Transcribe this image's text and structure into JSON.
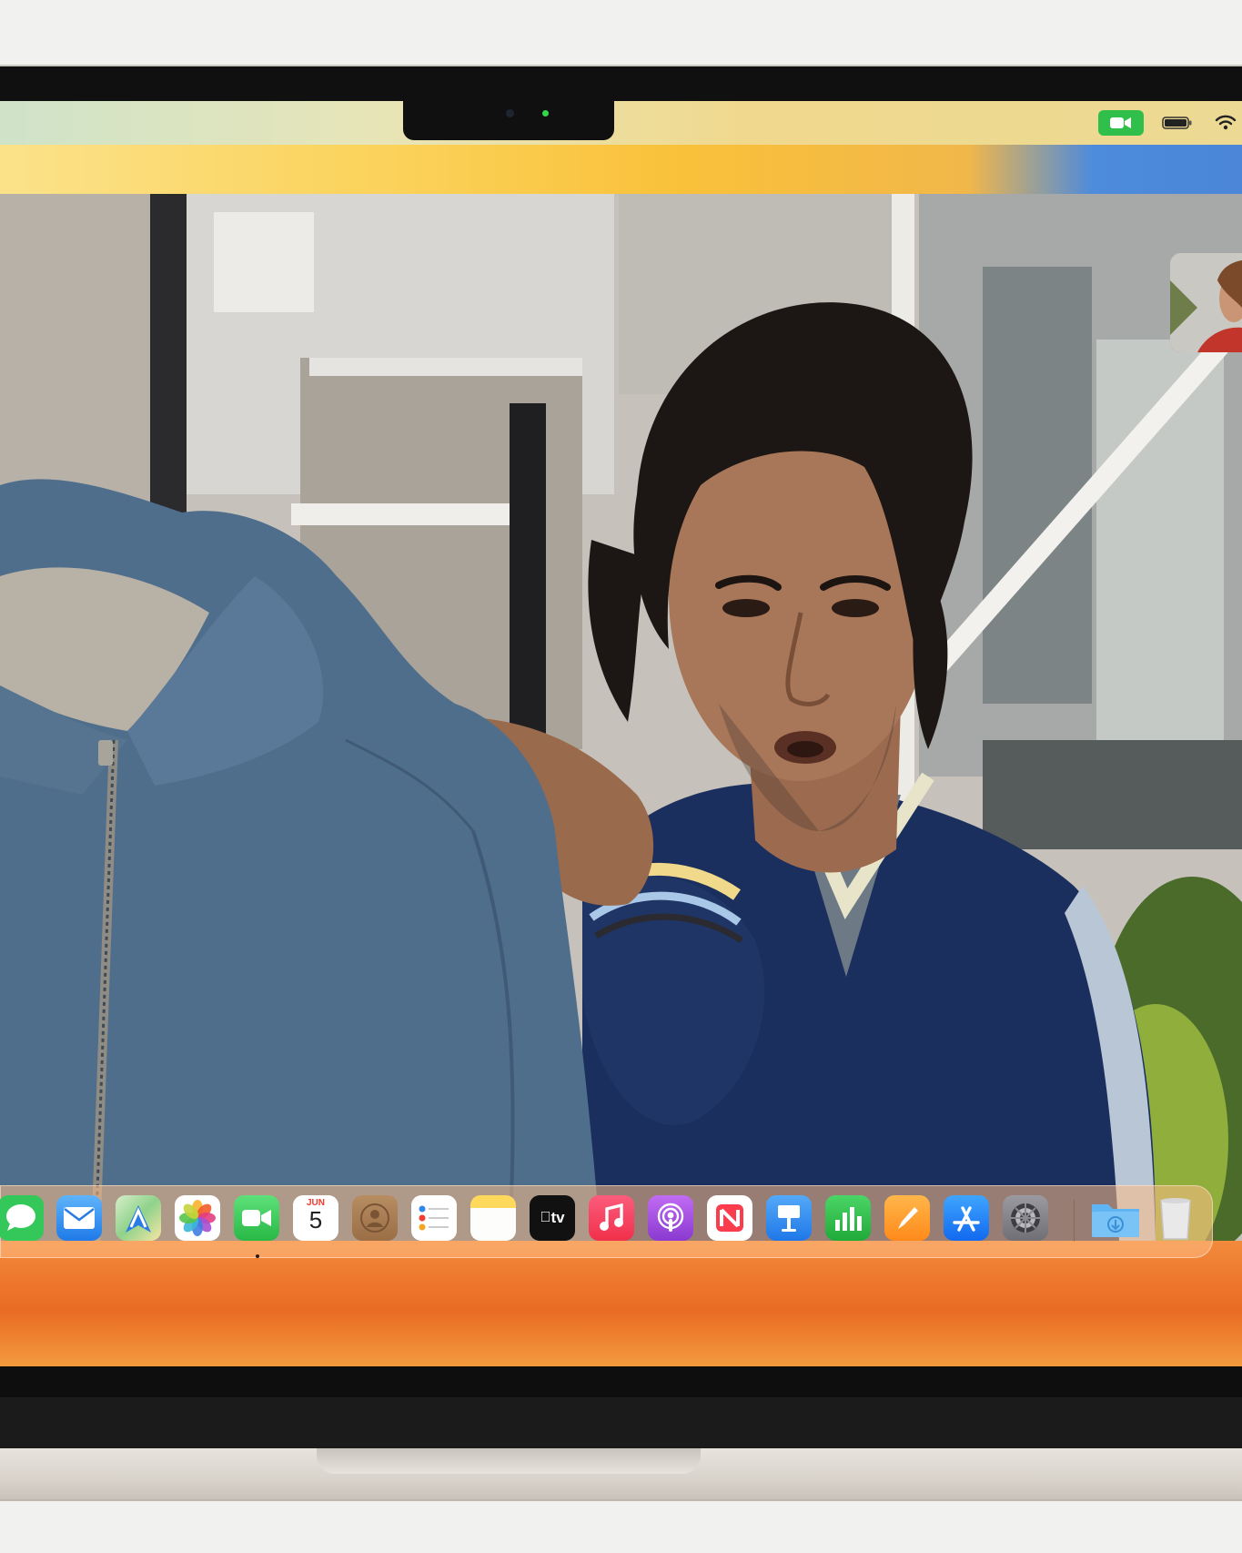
{
  "menubar": {
    "status_icons": [
      "facetime-video-icon",
      "battery-icon",
      "wifi-icon"
    ]
  },
  "facetime": {
    "main_video": "remote-participant-video",
    "self_view": "self-view-thumbnail"
  },
  "dock": {
    "apps": [
      {
        "name": "messages-icon",
        "color": "#34c759"
      },
      {
        "name": "mail-icon",
        "color": "#2f8cf5"
      },
      {
        "name": "maps-icon",
        "color": "#7fcf7a"
      },
      {
        "name": "photos-icon",
        "color": "#ffffff"
      },
      {
        "name": "facetime-icon",
        "color": "#34c759"
      },
      {
        "name": "calendar-icon",
        "color": "#ffffff"
      },
      {
        "name": "contacts-icon",
        "color": "#a77a4e"
      },
      {
        "name": "reminders-icon",
        "color": "#ffffff"
      },
      {
        "name": "notes-icon",
        "color": "#ffd35a"
      },
      {
        "name": "apple-tv-icon",
        "color": "#111111"
      },
      {
        "name": "music-icon",
        "color": "#fa3a55"
      },
      {
        "name": "podcasts-icon",
        "color": "#a64ce0"
      },
      {
        "name": "news-icon",
        "color": "#ffffff"
      },
      {
        "name": "keynote-icon",
        "color": "#2a8cf0"
      },
      {
        "name": "numbers-icon",
        "color": "#29c34a"
      },
      {
        "name": "pages-icon",
        "color": "#ff9d2a"
      },
      {
        "name": "app-store-icon",
        "color": "#1a8cff"
      },
      {
        "name": "system-settings-icon",
        "color": "#8e8e93"
      },
      {
        "name": "downloads-folder-icon",
        "color": "#5bb3f2"
      },
      {
        "name": "trash-icon",
        "color": "#e6e6e6"
      }
    ],
    "calendar": {
      "month": "JUN",
      "day": "5"
    },
    "apple_tv_label": "tv",
    "active_app": "facetime-icon"
  }
}
